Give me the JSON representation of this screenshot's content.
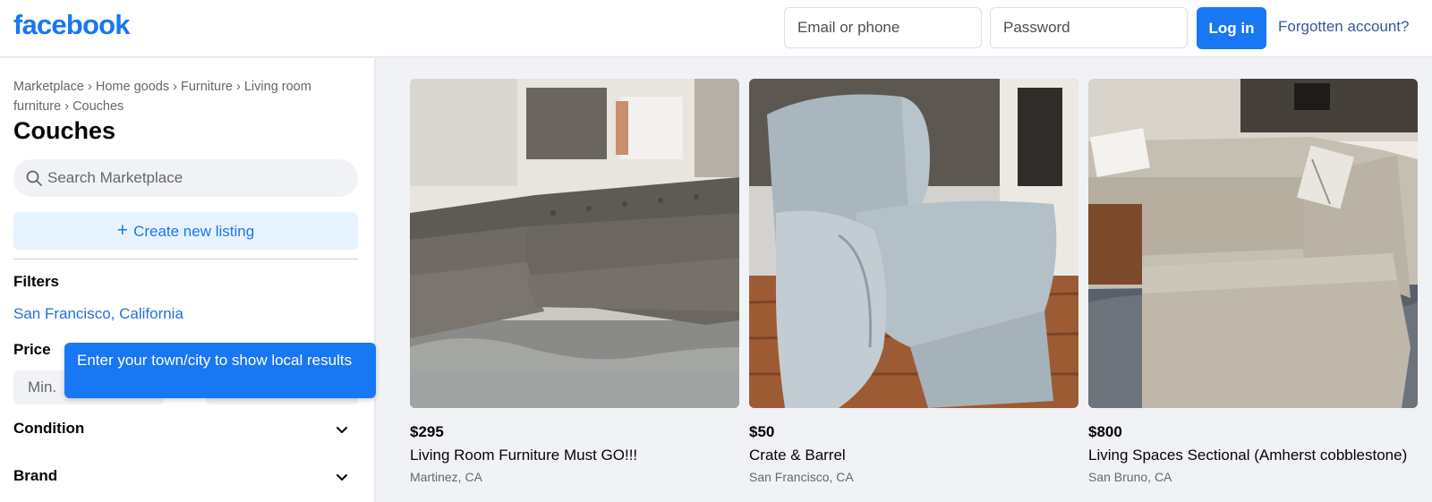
{
  "header": {
    "logo": "facebook",
    "email_placeholder": "Email or phone",
    "password_placeholder": "Password",
    "login_label": "Log in",
    "forgot_label": "Forgotten account?"
  },
  "sidebar": {
    "breadcrumb": "Marketplace › Home goods › Furniture › Living room furniture › Couches",
    "title": "Couches",
    "search_placeholder": "Search Marketplace",
    "create_listing": "Create new listing",
    "filters_label": "Filters",
    "location": "San Francisco, California",
    "price_label": "Price",
    "price_min_placeholder": "Min.",
    "tooltip": "Enter your town/city to show local results",
    "filters": [
      {
        "label": "Condition"
      },
      {
        "label": "Brand"
      }
    ]
  },
  "listings": [
    {
      "price": "$295",
      "title": "Living Room Furniture Must GO!!!",
      "location": "Martinez, CA",
      "image": "grey-tufted-sectional-sofa"
    },
    {
      "price": "$50",
      "title": "Crate & Barrel",
      "location": "San Francisco, CA",
      "image": "light-blue-armchair"
    },
    {
      "price": "$800",
      "title": "Living Spaces Sectional (Amherst cobblestone)",
      "location": "San Bruno, CA",
      "image": "beige-sectional-sofa"
    }
  ],
  "colors": {
    "brand": "#1877f2",
    "link": "#216fdb",
    "page_bg": "#f0f2f5"
  }
}
